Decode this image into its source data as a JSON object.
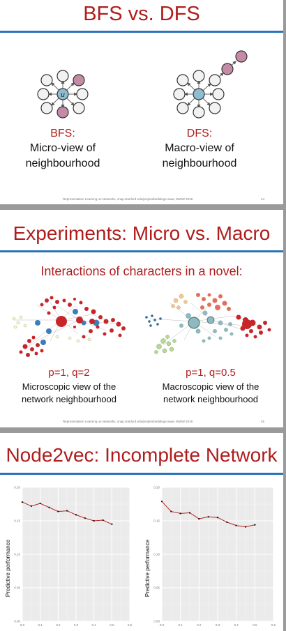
{
  "slide1": {
    "title": "BFS vs. DFS",
    "left_label": "BFS:",
    "left_desc1": "Micro-view of",
    "left_desc2": "neighbourhood",
    "right_label": "DFS:",
    "right_desc1": "Macro-view of",
    "right_desc2": "neighbourhood",
    "center_node": "u",
    "footer": "Representation Learning on Networks, snap.stanford.edu/proj/embeddings-www, WWW 2018",
    "page": "44"
  },
  "slide2": {
    "title": "Experiments: Micro vs. Macro",
    "subtitle": "Interactions of characters in a novel:",
    "left_params": "p=1, q=2",
    "left_desc1": "Microscopic view of the",
    "left_desc2": "network neighbourhood",
    "right_params": "p=1, q=0.5",
    "right_desc1": "Macroscopic view of the",
    "right_desc2": "network neighbourhood",
    "footer": "Representation Learning on Networks, snap.stanford.edu/proj/embeddings-www, WWW 2018",
    "page": "45"
  },
  "slide3": {
    "title": "Node2vec: Incomplete Network"
  },
  "colors": {
    "accent_red": "#b01c1c",
    "rule_blue": "#2a73b8",
    "node_pink": "#c48aa6",
    "node_blue": "#8fbdd0"
  },
  "chart_data": [
    {
      "type": "line",
      "ylabel": "Predictive performance",
      "x": [
        0.0,
        0.05,
        0.1,
        0.15,
        0.2,
        0.25,
        0.3,
        0.35,
        0.4,
        0.45,
        0.5
      ],
      "values": [
        0.178,
        0.172,
        0.176,
        0.17,
        0.164,
        0.165,
        0.159,
        0.154,
        0.15,
        0.151,
        0.145
      ],
      "xlim": [
        0.0,
        0.6
      ],
      "ylim": [
        0.0,
        0.2
      ],
      "xticks": [
        "0.0",
        "0.1",
        "0.2",
        "0.3",
        "0.4",
        "0.5",
        "0.6"
      ],
      "yticks": [
        "0.00",
        "0.05",
        "0.10",
        "0.15",
        "0.20"
      ],
      "grid": true
    },
    {
      "type": "line",
      "ylabel": "Predictive performance",
      "x": [
        0.0,
        0.05,
        0.1,
        0.15,
        0.2,
        0.25,
        0.3,
        0.35,
        0.4,
        0.45,
        0.5
      ],
      "values": [
        0.179,
        0.164,
        0.161,
        0.162,
        0.153,
        0.156,
        0.155,
        0.148,
        0.143,
        0.141,
        0.144
      ],
      "xlim": [
        0.0,
        0.6
      ],
      "ylim": [
        0.0,
        0.2
      ],
      "xticks": [
        "0.0",
        "0.1",
        "0.2",
        "0.3",
        "0.4",
        "0.5",
        "0.6"
      ],
      "yticks": [
        "0.00",
        "0.05",
        "0.10",
        "0.15",
        "0.20"
      ],
      "grid": true
    }
  ]
}
